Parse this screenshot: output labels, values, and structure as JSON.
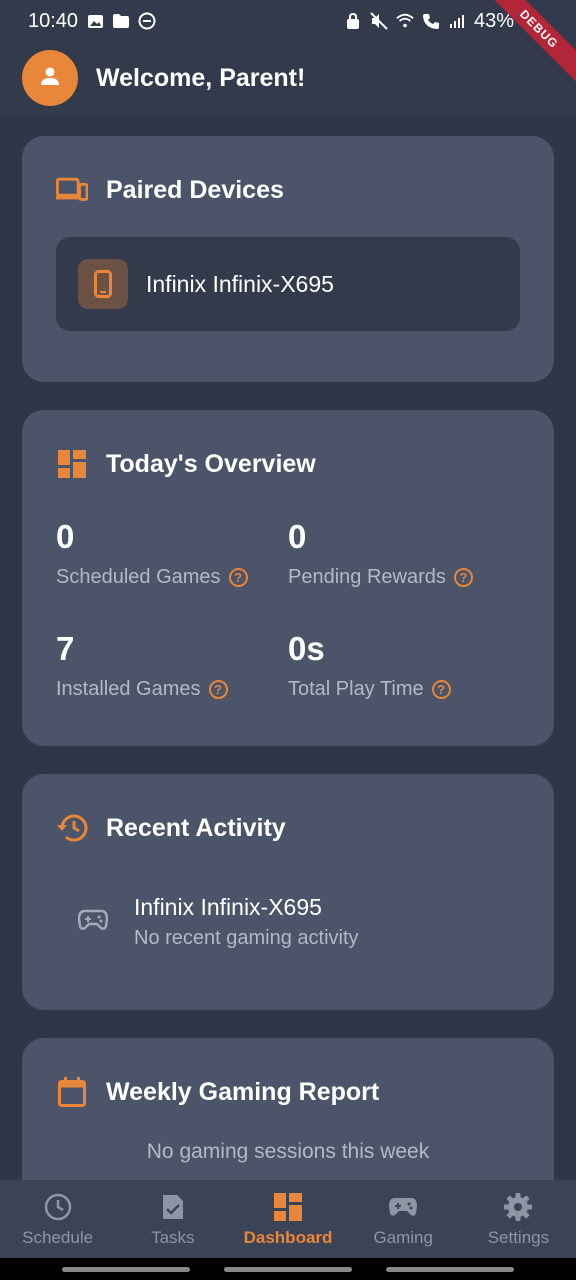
{
  "status_bar": {
    "time": "10:40",
    "battery": "43%",
    "debug_label": "DEBUG"
  },
  "header": {
    "welcome": "Welcome, Parent!"
  },
  "paired_devices": {
    "title": "Paired Devices",
    "devices": [
      {
        "name": "Infinix Infinix-X695"
      }
    ]
  },
  "overview": {
    "title": "Today's Overview",
    "stats": [
      {
        "value": "0",
        "label": "Scheduled Games"
      },
      {
        "value": "0",
        "label": "Pending Rewards"
      },
      {
        "value": "7",
        "label": "Installed Games"
      },
      {
        "value": "0s",
        "label": "Total Play Time"
      }
    ],
    "help_glyph": "?"
  },
  "recent_activity": {
    "title": "Recent Activity",
    "items": [
      {
        "device": "Infinix Infinix-X695",
        "status": "No recent gaming activity",
        "icon": "gamepad-icon"
      }
    ]
  },
  "weekly_report": {
    "title": "Weekly Gaming Report",
    "empty_text": "No gaming sessions this week"
  },
  "bottom_nav": {
    "items": [
      {
        "label": "Schedule",
        "icon": "clock-icon",
        "active": false
      },
      {
        "label": "Tasks",
        "icon": "task-icon",
        "active": false
      },
      {
        "label": "Dashboard",
        "icon": "dashboard-icon",
        "active": true
      },
      {
        "label": "Gaming",
        "icon": "gamepad-icon",
        "active": false
      },
      {
        "label": "Settings",
        "icon": "gear-icon",
        "active": false
      }
    ]
  },
  "colors": {
    "accent": "#e8863a",
    "background": "#323a4c",
    "card": "#4b5468"
  }
}
